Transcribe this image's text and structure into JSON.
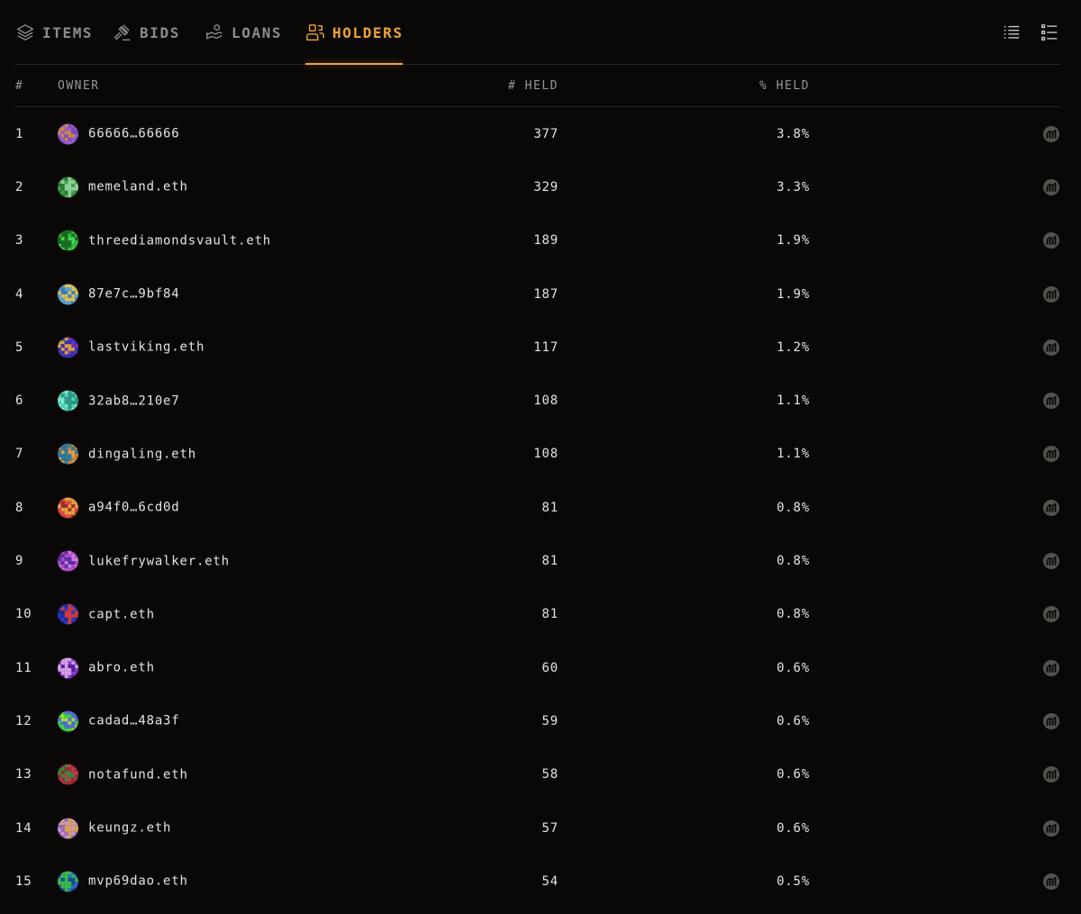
{
  "tabs": [
    {
      "label": "ITEMS",
      "icon": "layers-icon",
      "active": false
    },
    {
      "label": "BIDS",
      "icon": "gavel-icon",
      "active": false
    },
    {
      "label": "LOANS",
      "icon": "hand-coins-icon",
      "active": false
    },
    {
      "label": "HOLDERS",
      "icon": "users-icon",
      "active": true
    }
  ],
  "view_toggles": [
    "list-view-icon",
    "detailed-list-view-icon"
  ],
  "columns": {
    "rank": "#",
    "owner": "OWNER",
    "held": "# HELD",
    "pct": "% HELD"
  },
  "colors": {
    "accent": "#f0a338",
    "background": "#0a0807",
    "muted": "#8f8b87"
  },
  "holders": [
    {
      "rank": "1",
      "owner": "66666…66666",
      "held": "377",
      "pct": "3.8%",
      "avatar": [
        "#9a5bd6",
        "#c98a4a",
        "#7a4cc4"
      ]
    },
    {
      "rank": "2",
      "owner": "memeland.eth",
      "held": "329",
      "pct": "3.3%",
      "avatar": [
        "#3fa64a",
        "#8fd19a",
        "#2a7a35"
      ]
    },
    {
      "rank": "3",
      "owner": "threediamondsvault.eth",
      "held": "189",
      "pct": "1.9%",
      "avatar": [
        "#2fbf3a",
        "#1a6e22",
        "#49d156"
      ]
    },
    {
      "rank": "4",
      "owner": "87e7c…9bf84",
      "held": "187",
      "pct": "1.9%",
      "avatar": [
        "#5aa0d8",
        "#d8c25a",
        "#3f7fb8"
      ]
    },
    {
      "rank": "5",
      "owner": "lastviking.eth",
      "held": "117",
      "pct": "1.2%",
      "avatar": [
        "#2a33b8",
        "#d6a040",
        "#7a2fb8"
      ]
    },
    {
      "rank": "6",
      "owner": "32ab8…210e7",
      "held": "108",
      "pct": "1.1%",
      "avatar": [
        "#4ad6b8",
        "#2f9a88",
        "#7ae8d0"
      ]
    },
    {
      "rank": "7",
      "owner": "dingaling.eth",
      "held": "108",
      "pct": "1.1%",
      "avatar": [
        "#c8873a",
        "#2f7a9a",
        "#e0a050"
      ]
    },
    {
      "rank": "8",
      "owner": "a94f0…6cd0d",
      "held": "81",
      "pct": "0.8%",
      "avatar": [
        "#d84a4a",
        "#e8a03a",
        "#a03030"
      ]
    },
    {
      "rank": "9",
      "owner": "lukefrywalker.eth",
      "held": "81",
      "pct": "0.8%",
      "avatar": [
        "#b04ad0",
        "#5a2fa0",
        "#d07ae0"
      ]
    },
    {
      "rank": "10",
      "owner": "capt.eth",
      "held": "81",
      "pct": "0.8%",
      "avatar": [
        "#2a3ad0",
        "#d03a3a",
        "#1a2a9a"
      ]
    },
    {
      "rank": "11",
      "owner": "abro.eth",
      "held": "60",
      "pct": "0.6%",
      "avatar": [
        "#8a3ad0",
        "#d0a0e8",
        "#5a1a9a"
      ]
    },
    {
      "rank": "12",
      "owner": "cadad…48a3f",
      "held": "59",
      "pct": "0.6%",
      "avatar": [
        "#3ad04a",
        "#5a6ad8",
        "#a0e03a"
      ]
    },
    {
      "rank": "13",
      "owner": "notafund.eth",
      "held": "58",
      "pct": "0.6%",
      "avatar": [
        "#a02a3a",
        "#3a8a3a",
        "#c03a4a"
      ]
    },
    {
      "rank": "14",
      "owner": "keungz.eth",
      "held": "57",
      "pct": "0.6%",
      "avatar": [
        "#c89ad8",
        "#d8a060",
        "#9a6ab8"
      ]
    },
    {
      "rank": "15",
      "owner": "mvp69dao.eth",
      "held": "54",
      "pct": "0.5%",
      "avatar": [
        "#2a6ad0",
        "#3ab84a",
        "#1a4a9a"
      ]
    }
  ]
}
